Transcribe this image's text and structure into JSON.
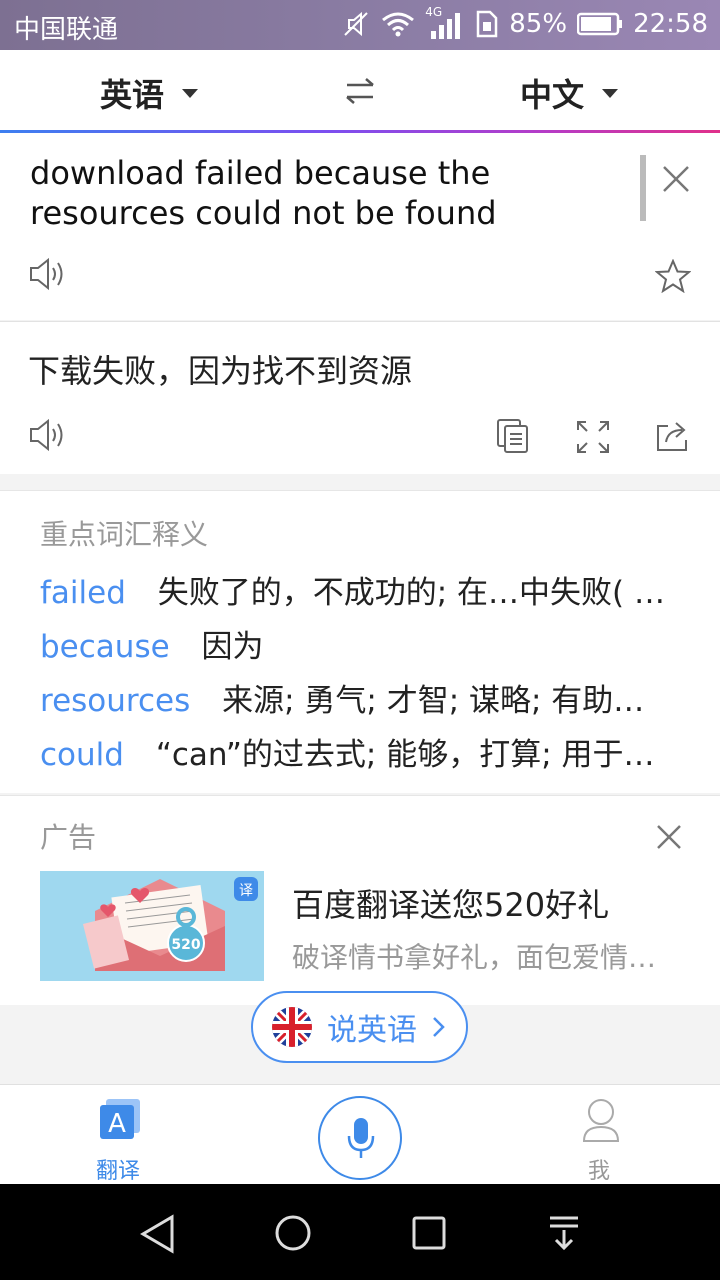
{
  "status_bar": {
    "carrier": "中国联通",
    "network": "4G",
    "battery": "85%",
    "time": "22:58"
  },
  "lang_bar": {
    "source_lang": "英语",
    "target_lang": "中文"
  },
  "input": {
    "text": "download failed because the resources could not be found"
  },
  "result": {
    "text": "下载失败，因为找不到资源"
  },
  "vocab": {
    "title": "重点词汇释义",
    "items": [
      {
        "word": "failed",
        "def": "失败了的，不成功的; 在…中失败( …"
      },
      {
        "word": "because",
        "def": "因为"
      },
      {
        "word": "resources",
        "def": "来源; 勇气; 才智; 谋略; 有助…"
      },
      {
        "word": "could",
        "def": "“can”的过去式; 能够，打算; 用于…"
      }
    ]
  },
  "ad": {
    "label": "广告",
    "title": "百度翻译送您520好礼",
    "subtitle": "破译情书拿好礼，面包爱情…",
    "thumb_badge": "520",
    "thumb_corner": "译"
  },
  "speak_button": {
    "label": "说英语"
  },
  "bottom_nav": {
    "translate_label": "翻译",
    "translate_icon_letter": "A",
    "me_label": "我"
  },
  "colors": {
    "accent": "#4a8ff0",
    "status_bar": "#8a7ca3",
    "vocab_word": "#4a8ff0"
  }
}
